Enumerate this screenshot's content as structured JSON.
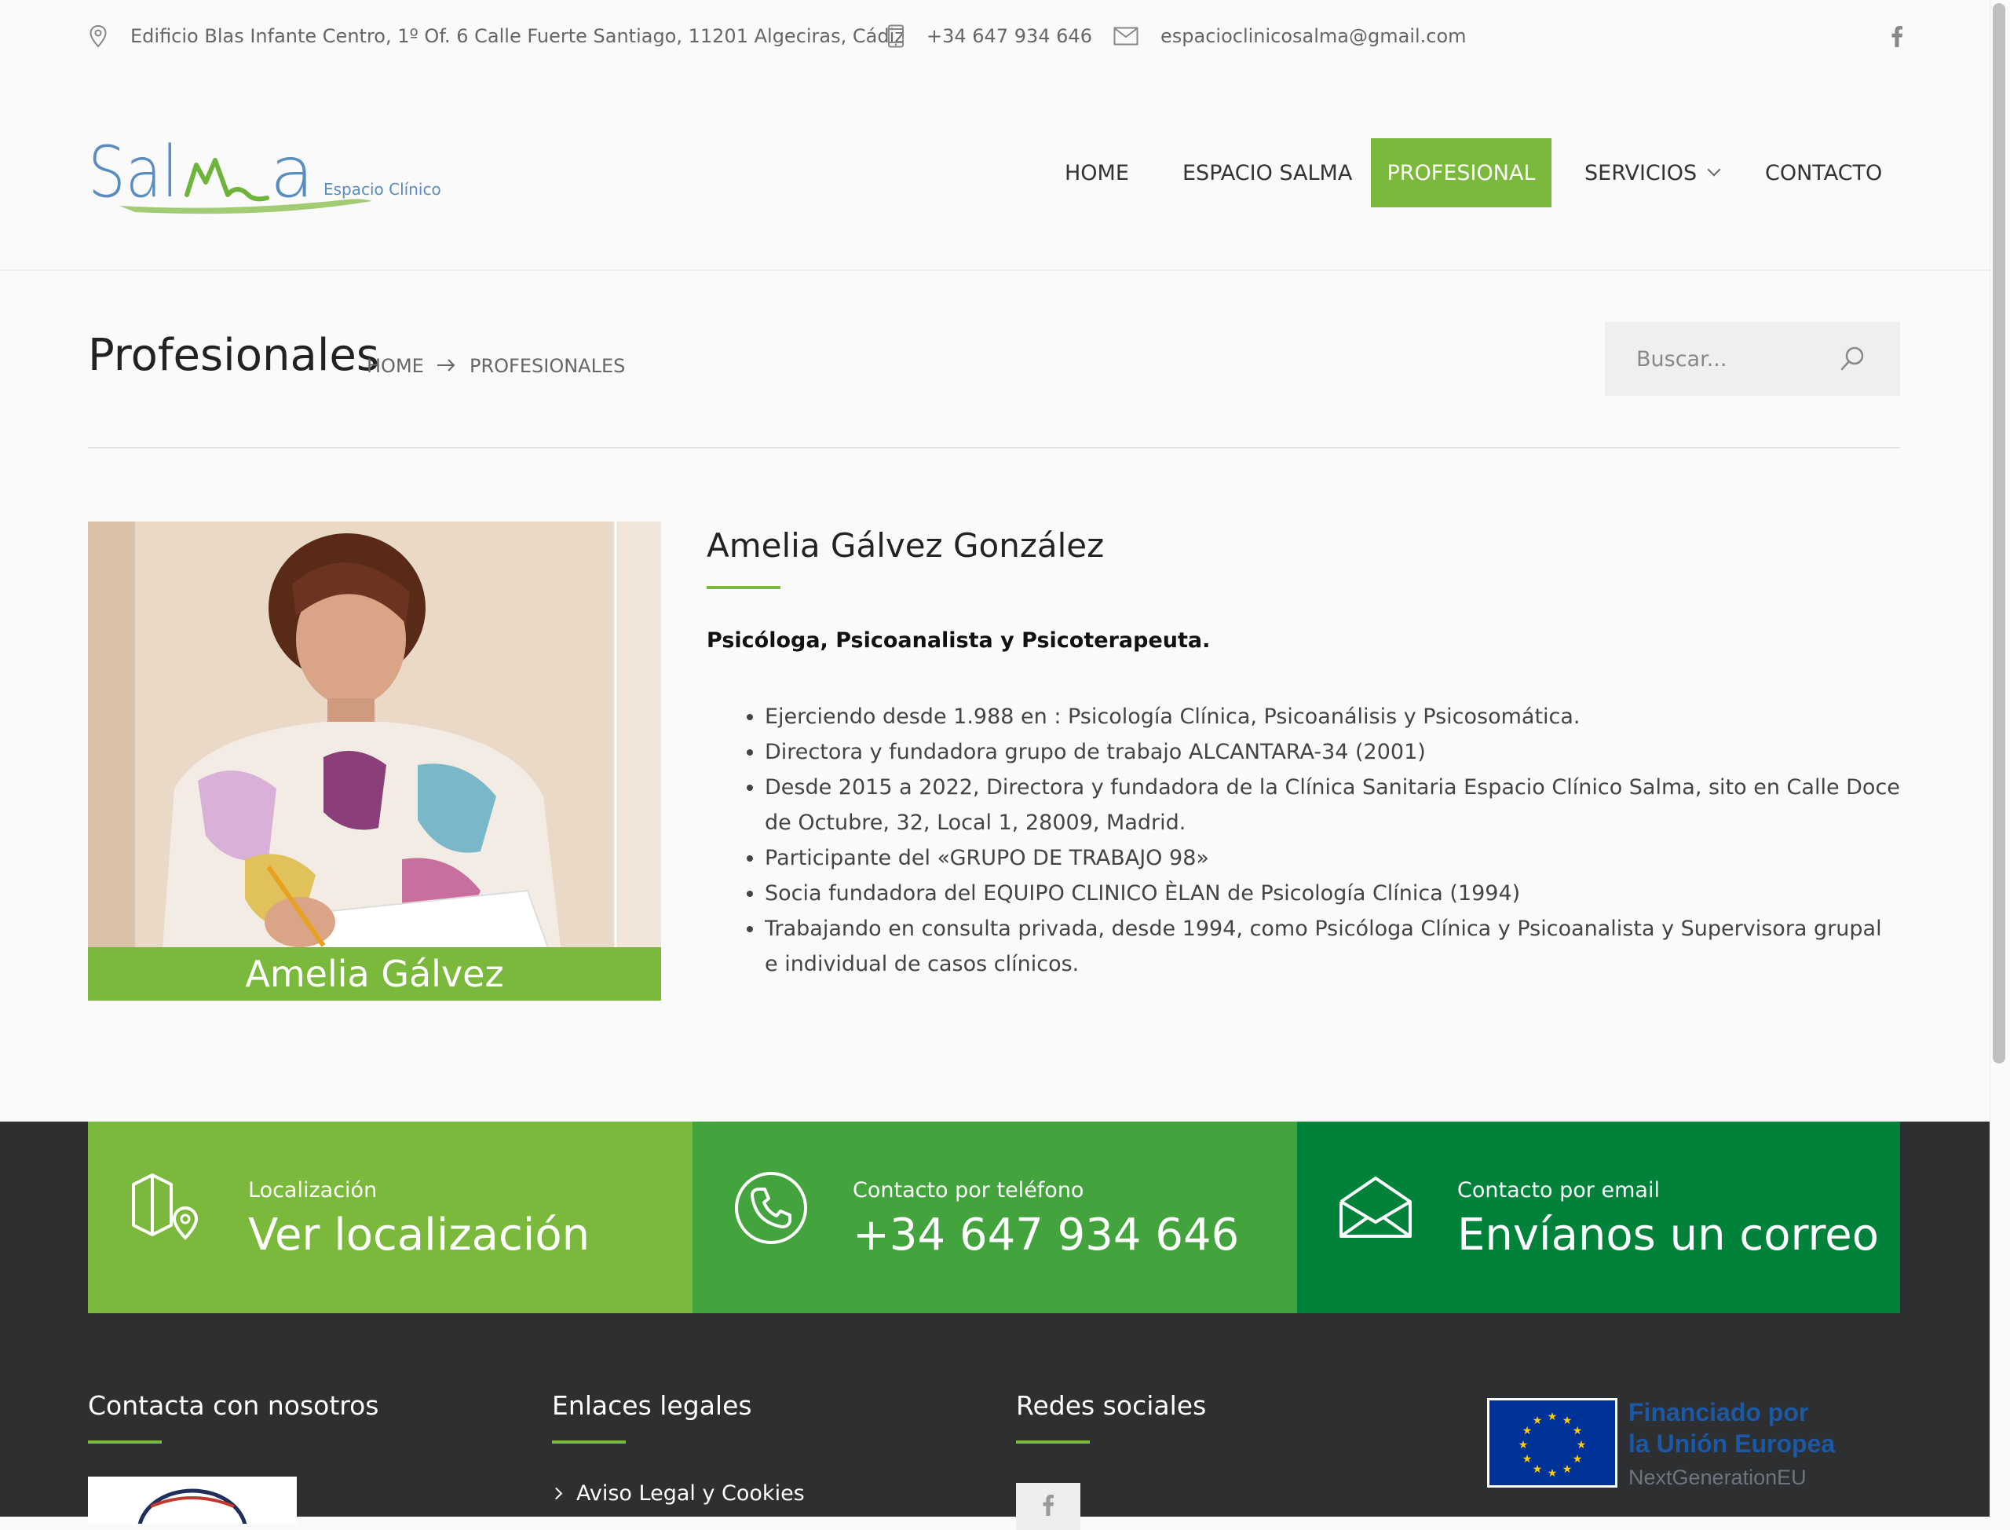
{
  "topbar": {
    "address": "Edificio Blas Infante Centro, 1º Of. 6 Calle Fuerte Santiago, 11201 Algeciras, Cádiz",
    "phone": "+34 647 934 646",
    "email": "espacioclinicosalma@gmail.com"
  },
  "logo": {
    "word": "Salma",
    "tagline": "Espacio Clínico"
  },
  "nav": {
    "items": [
      {
        "label": "HOME"
      },
      {
        "label": "ESPACIO SALMA"
      },
      {
        "label": "PROFESIONAL"
      },
      {
        "label": "SERVICIOS"
      },
      {
        "label": "CONTACTO"
      }
    ]
  },
  "page": {
    "title": "Profesionales",
    "breadcrumb": [
      "HOME",
      "PROFESIONALES"
    ],
    "search_placeholder": "Buscar..."
  },
  "profile": {
    "photo_caption": "Amelia Gálvez",
    "name": "Amelia Gálvez González",
    "role": "Psicóloga, Psicoanalista y Psicoterapeuta.",
    "bullets": [
      "Ejerciendo desde 1.988 en : Psicología Clínica, Psicoanálisis y Psicosomática.",
      "Directora y fundadora grupo de trabajo ALCANTARA-34 (2001)",
      "Desde 2015 a 2022, Directora y fundadora de la Clínica Sanitaria Espacio Clínico Salma, sito en Calle Doce de Octubre, 32, Local 1, 28009, Madrid.",
      "Participante del «GRUPO DE TRABAJO 98»",
      "Socia fundadora del EQUIPO CLINICO ÈLAN de Psicología Clínica (1994)",
      "Trabajando en consulta privada, desde 1994, como Psicóloga Clínica y Psicoanalista y Supervisora grupal e individual de casos clínicos."
    ]
  },
  "contact_boxes": [
    {
      "label": "Localización",
      "value": "Ver localización",
      "color": "#7bb93d"
    },
    {
      "label": "Contacto por teléfono",
      "value": "+34 647 934 646",
      "color": "#43a33d"
    },
    {
      "label": "Contacto por email",
      "value": "Envíanos un correo",
      "color": "#00823a"
    }
  ],
  "footer": {
    "col1_title": "Contacta con nosotros",
    "col2_title": "Enlaces legales",
    "col2_links": [
      "Aviso Legal y Cookies"
    ],
    "col3_title": "Redes sociales",
    "eu_line1": "Financiado por",
    "eu_line2": "la Unión Europea",
    "eu_sub": "NextGenerationEU"
  },
  "colors": {
    "accent": "#7bb93d",
    "dark": "#2d2f31"
  }
}
